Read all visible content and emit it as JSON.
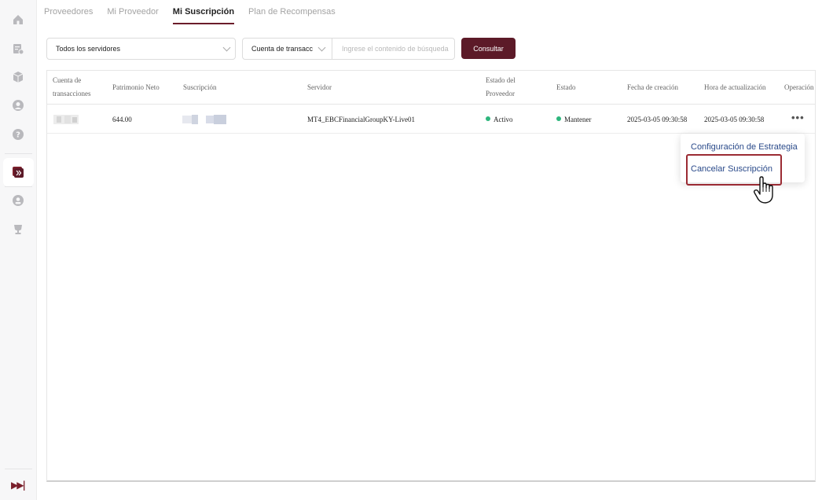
{
  "tabs": [
    {
      "label": "Proveedores",
      "active": false
    },
    {
      "label": "Mi Proveedor",
      "active": false
    },
    {
      "label": "Mi Suscripción",
      "active": true
    },
    {
      "label": "Plan de Recompensas",
      "active": false
    }
  ],
  "filters": {
    "server_select": "Todos los servidores",
    "account_select": "Cuenta de transacciones",
    "search_placeholder": "Ingrese el contenido de búsqueda",
    "query_button": "Consultar"
  },
  "table": {
    "headers": {
      "account": [
        "Cuenta de",
        "transacciones"
      ],
      "equity": "Patrimonio Neto",
      "subscription": "Suscripción",
      "server": "Servidor",
      "provider_status": [
        "Estado del",
        "Proveedor"
      ],
      "status": "Estado",
      "created": "Fecha de creación",
      "updated": "Hora de actualización",
      "operation": "Operación"
    },
    "rows": [
      {
        "equity": "644.00",
        "server": "MT4_EBCFinancialGroupKY-Live01",
        "provider_status": "Activo",
        "status": "Mantener",
        "created": "2025-03-05 09:30:58",
        "updated": "2025-03-05 09:30:58"
      }
    ]
  },
  "menu": {
    "strategy_config": "Configuración de Estrategia",
    "cancel_subscription": "Cancelar Suscripción"
  },
  "colors": {
    "accent": "#5c1a28",
    "status_green": "#2eb67d",
    "menu_link": "#2a4a8a",
    "highlight": "#9b2b33"
  },
  "icons": {
    "sidebar": [
      "home-icon",
      "report-icon",
      "box-icon",
      "user-icon",
      "help-icon",
      "copy-trade-icon",
      "profile-icon",
      "trophy-icon",
      "expand-icon"
    ]
  }
}
